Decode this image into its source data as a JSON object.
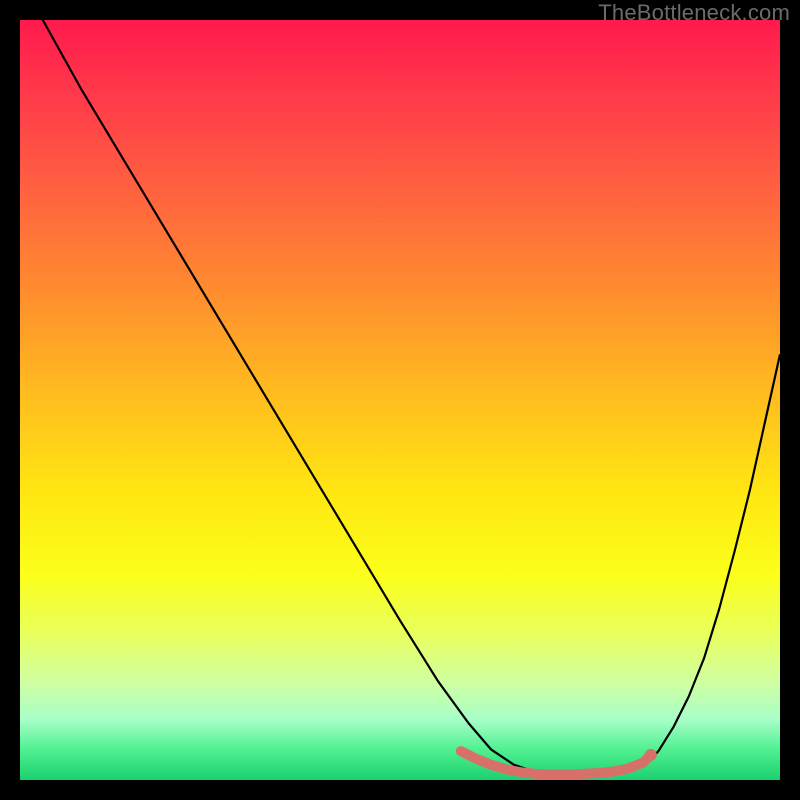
{
  "watermark": {
    "text": "TheBottleneck.com"
  },
  "chart_data": {
    "type": "line",
    "title": "",
    "xlabel": "",
    "ylabel": "",
    "xlim": [
      0,
      100
    ],
    "ylim": [
      0,
      100
    ],
    "series": [
      {
        "name": "bottleneck-curve",
        "color": "#000000",
        "x": [
          0,
          3,
          8,
          14,
          20,
          26,
          32,
          38,
          44,
          50,
          55,
          59,
          62,
          65,
          68,
          71,
          74,
          77,
          80,
          82.5,
          84,
          86,
          88,
          90,
          92,
          94,
          96,
          98,
          100
        ],
        "values": [
          107,
          100,
          91,
          81,
          71,
          61,
          51,
          41,
          31,
          21,
          13,
          7.5,
          4,
          2,
          1,
          0.6,
          0.5,
          0.6,
          1,
          2.2,
          3.8,
          7,
          11,
          16,
          22.5,
          30,
          38,
          47,
          56
        ]
      },
      {
        "name": "valley-marker",
        "color": "#d8706a",
        "x": [
          58,
          60,
          62,
          64,
          66,
          68,
          70,
          72,
          74,
          76,
          78,
          80,
          82,
          83
        ],
        "values": [
          3.8,
          2.8,
          2.0,
          1.4,
          1.0,
          0.8,
          0.7,
          0.7,
          0.8,
          0.9,
          1.1,
          1.5,
          2.3,
          3.3
        ]
      }
    ],
    "marker_endpoint": {
      "x": 83,
      "y": 3.3,
      "r": 6,
      "color": "#d8706a"
    }
  }
}
